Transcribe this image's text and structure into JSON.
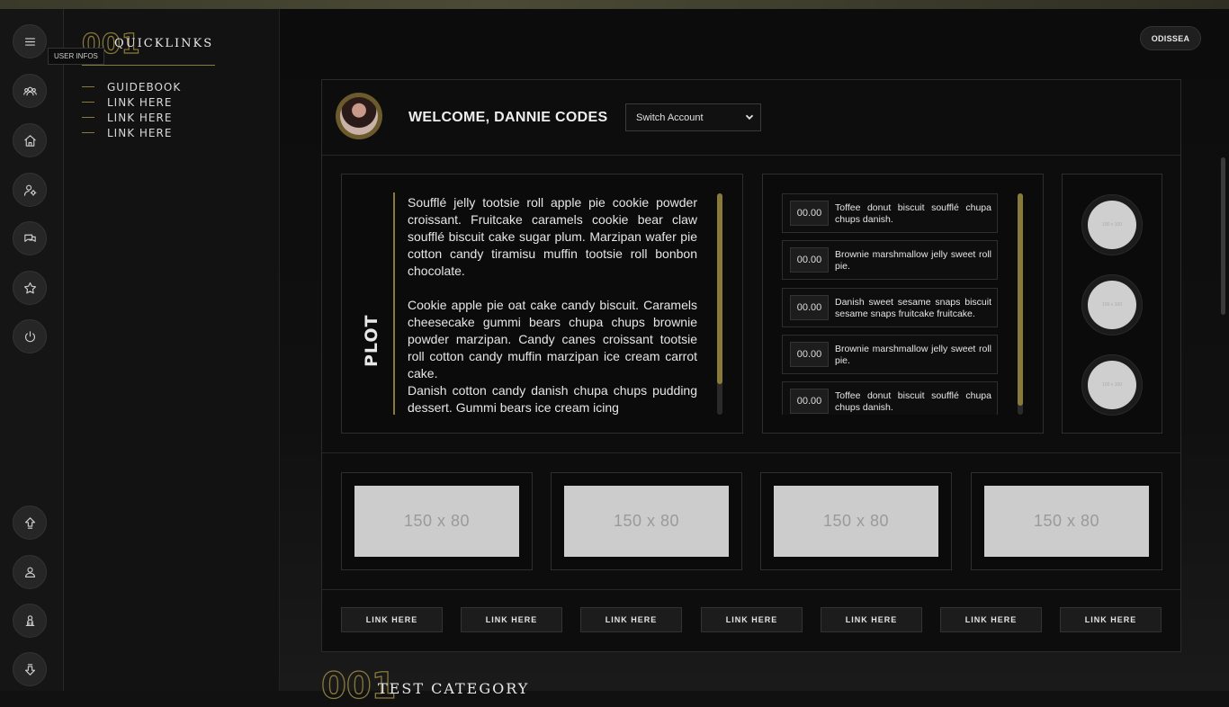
{
  "sidebar": {
    "tooltip": "USER INFOS",
    "icons": [
      "menu-icon",
      "users-icon",
      "home-icon",
      "user-settings-icon",
      "chat-icon",
      "star-icon",
      "power-icon",
      "arrow-up-icon",
      "profile-icon",
      "group-icon",
      "arrow-down-icon"
    ]
  },
  "quicklinks": {
    "number": "001",
    "title": "QUICKLINKS",
    "links": [
      "GUIDEBOOK",
      "LINK HERE",
      "LINK HERE",
      "LINK HERE"
    ]
  },
  "header": {
    "user_button": "ODISSEA",
    "welcome": "WELCOME, DANNIE CODES",
    "switch_account": "Switch Account"
  },
  "plot": {
    "label": "PLOT",
    "paragraphs": [
      "Soufflé jelly tootsie roll apple pie cookie powder croissant. Fruitcake caramels cookie bear claw soufflé biscuit cake sugar plum. Marzipan wafer pie cotton candy tiramisu muffin tootsie roll bonbon chocolate.",
      "Cookie apple pie oat cake candy biscuit. Caramels cheesecake gummi bears chupa chups brownie powder marzipan. Candy canes croissant tootsie roll cotton candy muffin marzipan ice cream carrot cake.",
      "Danish cotton candy danish chupa chups pudding dessert. Gummi bears ice cream icing"
    ]
  },
  "events": [
    {
      "time": "00.00",
      "text": "Toffee donut biscuit soufflé chupa chups danish."
    },
    {
      "time": "00.00",
      "text": "Brownie marshmallow jelly sweet roll pie."
    },
    {
      "time": "00.00",
      "text": "Danish sweet sesame snaps biscuit sesame snaps fruitcake fruitcake."
    },
    {
      "time": "00.00",
      "text": "Brownie marshmallow jelly sweet roll pie."
    },
    {
      "time": "00.00",
      "text": "Toffee donut biscuit soufflé chupa chups danish."
    }
  ],
  "circles": [
    "100 x 100",
    "100 x 100",
    "100 x 100"
  ],
  "thumbnails": [
    "150 x 80",
    "150 x 80",
    "150 x 80",
    "150 x 80"
  ],
  "footer_links": [
    "LINK HERE",
    "LINK HERE",
    "LINK HERE",
    "LINK HERE",
    "LINK HERE",
    "LINK HERE",
    "LINK HERE"
  ],
  "next_section": {
    "number": "001",
    "title": "TEST CATEGORY"
  },
  "colors": {
    "accent": "#8a7a3a",
    "background": "#111111",
    "panel": "#0d0d0d"
  }
}
